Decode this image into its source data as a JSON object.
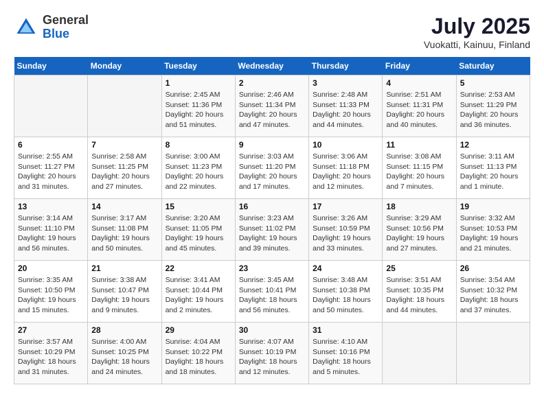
{
  "header": {
    "logo_general": "General",
    "logo_blue": "Blue",
    "month_title": "July 2025",
    "location": "Vuokatti, Kainuu, Finland"
  },
  "days_of_week": [
    "Sunday",
    "Monday",
    "Tuesday",
    "Wednesday",
    "Thursday",
    "Friday",
    "Saturday"
  ],
  "weeks": [
    [
      {
        "day": "",
        "info": ""
      },
      {
        "day": "",
        "info": ""
      },
      {
        "day": "1",
        "info": "Sunrise: 2:45 AM\nSunset: 11:36 PM\nDaylight: 20 hours and 51 minutes."
      },
      {
        "day": "2",
        "info": "Sunrise: 2:46 AM\nSunset: 11:34 PM\nDaylight: 20 hours and 47 minutes."
      },
      {
        "day": "3",
        "info": "Sunrise: 2:48 AM\nSunset: 11:33 PM\nDaylight: 20 hours and 44 minutes."
      },
      {
        "day": "4",
        "info": "Sunrise: 2:51 AM\nSunset: 11:31 PM\nDaylight: 20 hours and 40 minutes."
      },
      {
        "day": "5",
        "info": "Sunrise: 2:53 AM\nSunset: 11:29 PM\nDaylight: 20 hours and 36 minutes."
      }
    ],
    [
      {
        "day": "6",
        "info": "Sunrise: 2:55 AM\nSunset: 11:27 PM\nDaylight: 20 hours and 31 minutes."
      },
      {
        "day": "7",
        "info": "Sunrise: 2:58 AM\nSunset: 11:25 PM\nDaylight: 20 hours and 27 minutes."
      },
      {
        "day": "8",
        "info": "Sunrise: 3:00 AM\nSunset: 11:23 PM\nDaylight: 20 hours and 22 minutes."
      },
      {
        "day": "9",
        "info": "Sunrise: 3:03 AM\nSunset: 11:20 PM\nDaylight: 20 hours and 17 minutes."
      },
      {
        "day": "10",
        "info": "Sunrise: 3:06 AM\nSunset: 11:18 PM\nDaylight: 20 hours and 12 minutes."
      },
      {
        "day": "11",
        "info": "Sunrise: 3:08 AM\nSunset: 11:15 PM\nDaylight: 20 hours and 7 minutes."
      },
      {
        "day": "12",
        "info": "Sunrise: 3:11 AM\nSunset: 11:13 PM\nDaylight: 20 hours and 1 minute."
      }
    ],
    [
      {
        "day": "13",
        "info": "Sunrise: 3:14 AM\nSunset: 11:10 PM\nDaylight: 19 hours and 56 minutes."
      },
      {
        "day": "14",
        "info": "Sunrise: 3:17 AM\nSunset: 11:08 PM\nDaylight: 19 hours and 50 minutes."
      },
      {
        "day": "15",
        "info": "Sunrise: 3:20 AM\nSunset: 11:05 PM\nDaylight: 19 hours and 45 minutes."
      },
      {
        "day": "16",
        "info": "Sunrise: 3:23 AM\nSunset: 11:02 PM\nDaylight: 19 hours and 39 minutes."
      },
      {
        "day": "17",
        "info": "Sunrise: 3:26 AM\nSunset: 10:59 PM\nDaylight: 19 hours and 33 minutes."
      },
      {
        "day": "18",
        "info": "Sunrise: 3:29 AM\nSunset: 10:56 PM\nDaylight: 19 hours and 27 minutes."
      },
      {
        "day": "19",
        "info": "Sunrise: 3:32 AM\nSunset: 10:53 PM\nDaylight: 19 hours and 21 minutes."
      }
    ],
    [
      {
        "day": "20",
        "info": "Sunrise: 3:35 AM\nSunset: 10:50 PM\nDaylight: 19 hours and 15 minutes."
      },
      {
        "day": "21",
        "info": "Sunrise: 3:38 AM\nSunset: 10:47 PM\nDaylight: 19 hours and 9 minutes."
      },
      {
        "day": "22",
        "info": "Sunrise: 3:41 AM\nSunset: 10:44 PM\nDaylight: 19 hours and 2 minutes."
      },
      {
        "day": "23",
        "info": "Sunrise: 3:45 AM\nSunset: 10:41 PM\nDaylight: 18 hours and 56 minutes."
      },
      {
        "day": "24",
        "info": "Sunrise: 3:48 AM\nSunset: 10:38 PM\nDaylight: 18 hours and 50 minutes."
      },
      {
        "day": "25",
        "info": "Sunrise: 3:51 AM\nSunset: 10:35 PM\nDaylight: 18 hours and 44 minutes."
      },
      {
        "day": "26",
        "info": "Sunrise: 3:54 AM\nSunset: 10:32 PM\nDaylight: 18 hours and 37 minutes."
      }
    ],
    [
      {
        "day": "27",
        "info": "Sunrise: 3:57 AM\nSunset: 10:29 PM\nDaylight: 18 hours and 31 minutes."
      },
      {
        "day": "28",
        "info": "Sunrise: 4:00 AM\nSunset: 10:25 PM\nDaylight: 18 hours and 24 minutes."
      },
      {
        "day": "29",
        "info": "Sunrise: 4:04 AM\nSunset: 10:22 PM\nDaylight: 18 hours and 18 minutes."
      },
      {
        "day": "30",
        "info": "Sunrise: 4:07 AM\nSunset: 10:19 PM\nDaylight: 18 hours and 12 minutes."
      },
      {
        "day": "31",
        "info": "Sunrise: 4:10 AM\nSunset: 10:16 PM\nDaylight: 18 hours and 5 minutes."
      },
      {
        "day": "",
        "info": ""
      },
      {
        "day": "",
        "info": ""
      }
    ]
  ]
}
